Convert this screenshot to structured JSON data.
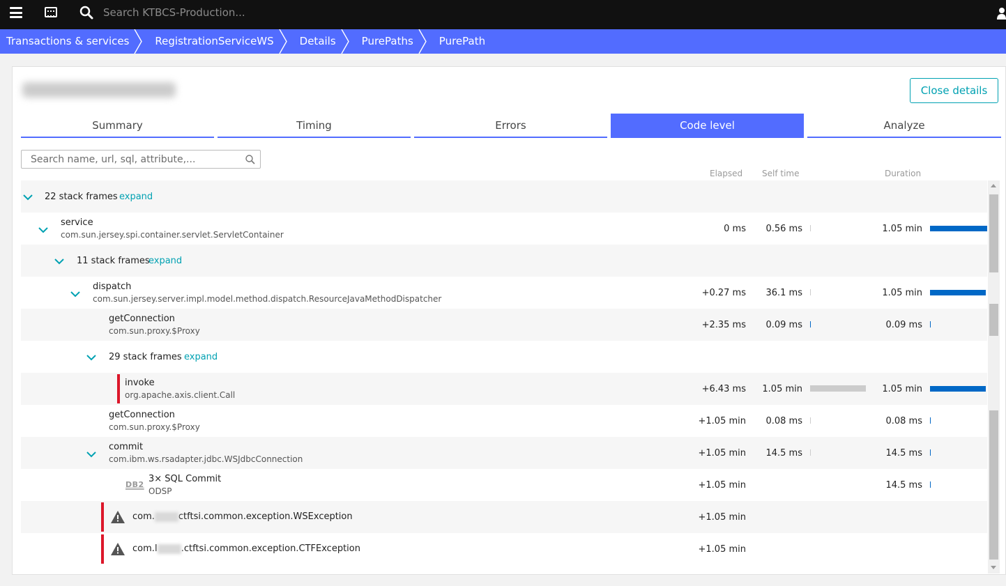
{
  "topbar": {
    "search_placeholder": "Search KTBCS-Production...",
    "menu_icon": "hamburger-icon",
    "keyboard_icon": "keyboard-icon",
    "search_icon": "search-icon",
    "user_icon": "user-icon"
  },
  "breadcrumb": {
    "items": [
      "Transactions & services",
      "RegistrationServiceWS",
      "Details",
      "PurePaths",
      "PurePath"
    ]
  },
  "header": {
    "close_label": "Close details"
  },
  "tabs": [
    {
      "label": "Summary",
      "active": false
    },
    {
      "label": "Timing",
      "active": false
    },
    {
      "label": "Errors",
      "active": false
    },
    {
      "label": "Code level",
      "active": true
    },
    {
      "label": "Analyze",
      "active": false
    }
  ],
  "filter": {
    "placeholder": "Search name, url, sql, attribute,..."
  },
  "columns": {
    "elapsed": "Elapsed",
    "self_time": "Self time",
    "duration": "Duration"
  },
  "rows": [
    {
      "frames": "22 stack frames",
      "expand": "expand"
    },
    {
      "name": "service",
      "sub": "com.sun.jersey.spi.container.servlet.ServletContainer",
      "elapsed": "0 ms",
      "self": "0.56 ms",
      "duration": "1.05 min",
      "duration_fraction": 1.0
    },
    {
      "frames": "11 stack frames",
      "expand": "expand"
    },
    {
      "name": "dispatch",
      "sub": "com.sun.jersey.server.impl.model.method.dispatch.ResourceJavaMethodDispatcher",
      "elapsed": "+0.27 ms",
      "self": "36.1 ms",
      "duration": "1.05 min",
      "duration_fraction": 0.99
    },
    {
      "name": "getConnection",
      "sub": "com.sun.proxy.$Proxy",
      "elapsed": "+2.35 ms",
      "self": "0.09 ms",
      "duration": "0.09 ms"
    },
    {
      "frames": "29 stack frames",
      "expand": "expand"
    },
    {
      "name": "invoke",
      "sub": "org.apache.axis.client.Call",
      "elapsed": "+6.43 ms",
      "self": "1.05 min",
      "duration": "1.05 min",
      "self_fraction": 1.0,
      "duration_fraction": 0.99
    },
    {
      "name": "getConnection",
      "sub": "com.sun.proxy.$Proxy",
      "elapsed": "+1.05 min",
      "self": "0.08 ms",
      "duration": "0.08 ms"
    },
    {
      "name": "commit",
      "sub": "com.ibm.ws.rsadapter.jdbc.WSJdbcConnection",
      "elapsed": "+1.05 min",
      "self": "14.5 ms",
      "duration": "14.5 ms"
    },
    {
      "name": "3× SQL Commit",
      "sub": "ODSP",
      "db_label": "DB2",
      "elapsed": "+1.05 min",
      "duration": "14.5 ms"
    },
    {
      "ex_prefix": "com.",
      "ex_suffix": "ctftsi.common.exception.WSException",
      "elapsed": "+1.05 min"
    },
    {
      "ex_prefix": "com.I",
      "ex_suffix": ".ctftsi.common.exception.CTFException",
      "elapsed": "+1.05 min"
    }
  ],
  "colors": {
    "accent": "#526cff",
    "link": "#00a1b2",
    "error": "#dc172a",
    "bar": "#0068c6"
  }
}
